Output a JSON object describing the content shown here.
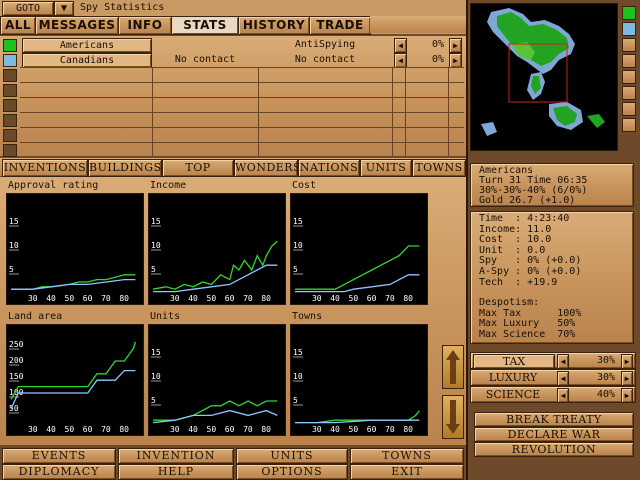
{
  "window": {
    "goto_label": "GOTO",
    "pin_glyph": "▼",
    "title": "Spy Statistics"
  },
  "tabs": [
    {
      "label": "ALL"
    },
    {
      "label": "MESSAGES"
    },
    {
      "label": "INFO"
    },
    {
      "label": "STATS",
      "active": true
    },
    {
      "label": "HISTORY"
    },
    {
      "label": "TRADE"
    }
  ],
  "nations": [
    {
      "name": "Americans",
      "col2": "",
      "col3": "AntiSpying",
      "pct": "0%",
      "color": "#1fc11f"
    },
    {
      "name": "Canadians",
      "col2": "No contact",
      "col3": "No contact",
      "pct": "0%",
      "color": "#7fb8e0"
    }
  ],
  "subtabs": [
    "INVENTIONS",
    "BUILDINGS",
    "TOP TOWNS",
    "WONDERS",
    "NATIONS",
    "UNITS",
    "TOWNS"
  ],
  "chart_data": [
    {
      "type": "line",
      "title": "Approval rating",
      "x_ticks": [
        "30",
        "40",
        "50",
        "60",
        "70",
        "80"
      ],
      "y_ticks": [
        "5",
        "10",
        "15"
      ],
      "xlim": [
        18,
        88
      ],
      "ylim": [
        0,
        20
      ],
      "series": [
        {
          "color": "#2fd82f",
          "x": [
            18,
            30,
            35,
            40,
            50,
            55,
            60,
            65,
            70,
            75,
            80,
            86
          ],
          "y": [
            1,
            1,
            1.5,
            1.5,
            2,
            2.5,
            2.5,
            3,
            3,
            3.5,
            4,
            4
          ]
        },
        {
          "color": "#8fc6ff",
          "x": [
            18,
            30,
            40,
            50,
            60,
            70,
            80,
            86
          ],
          "y": [
            1,
            1,
            1.5,
            2,
            2,
            2.5,
            3,
            3
          ]
        }
      ]
    },
    {
      "type": "line",
      "title": "Income",
      "x_ticks": [
        "30",
        "40",
        "50",
        "60",
        "70",
        "80"
      ],
      "y_ticks": [
        "5",
        "10",
        "15"
      ],
      "xlim": [
        18,
        88
      ],
      "ylim": [
        0,
        20
      ],
      "series": [
        {
          "color": "#2fd82f",
          "x": [
            18,
            25,
            30,
            35,
            40,
            45,
            50,
            55,
            60,
            62,
            65,
            68,
            70,
            72,
            75,
            78,
            80,
            83,
            86
          ],
          "y": [
            1,
            1.5,
            1,
            2,
            1.5,
            2.5,
            2,
            4,
            3,
            6,
            5,
            7,
            6,
            5,
            8,
            6,
            8,
            10,
            11
          ]
        },
        {
          "color": "#8fc6ff",
          "x": [
            18,
            30,
            40,
            50,
            60,
            65,
            70,
            75,
            80,
            86
          ],
          "y": [
            0.5,
            0.5,
            1,
            1.5,
            2,
            3,
            4,
            5,
            6,
            6
          ]
        }
      ]
    },
    {
      "type": "line",
      "title": "Cost",
      "x_ticks": [
        "30",
        "40",
        "50",
        "60",
        "70",
        "80"
      ],
      "y_ticks": [
        "5",
        "10",
        "15"
      ],
      "xlim": [
        18,
        88
      ],
      "ylim": [
        0,
        20
      ],
      "series": [
        {
          "color": "#2fd82f",
          "x": [
            18,
            40,
            45,
            50,
            55,
            60,
            65,
            70,
            75,
            80,
            86
          ],
          "y": [
            1,
            1,
            2,
            3,
            4,
            5,
            6,
            7,
            8,
            10,
            10
          ]
        },
        {
          "color": "#8fc6ff",
          "x": [
            18,
            45,
            50,
            60,
            70,
            75,
            80,
            86
          ],
          "y": [
            0.5,
            0.5,
            1,
            1.5,
            2,
            3,
            4,
            4
          ]
        }
      ]
    },
    {
      "type": "line",
      "title": "Land area",
      "x_ticks": [
        "30",
        "40",
        "50",
        "60",
        "70",
        "80"
      ],
      "y_ticks": [
        "50",
        "100",
        "150",
        "200",
        "250"
      ],
      "xlim": [
        18,
        88
      ],
      "ylim": [
        0,
        300
      ],
      "series": [
        {
          "color": "#2fd82f",
          "x": [
            18,
            22,
            40,
            60,
            65,
            70,
            75,
            80,
            85,
            86
          ],
          "y": [
            80,
            120,
            120,
            120,
            160,
            160,
            200,
            200,
            240,
            260
          ]
        },
        {
          "color": "#8fc6ff",
          "x": [
            18,
            22,
            40,
            60,
            65,
            75,
            80,
            86
          ],
          "y": [
            50,
            100,
            100,
            100,
            140,
            140,
            170,
            170
          ]
        }
      ]
    },
    {
      "type": "line",
      "title": "Units",
      "x_ticks": [
        "30",
        "40",
        "50",
        "60",
        "70",
        "80"
      ],
      "y_ticks": [
        "5",
        "10",
        "15"
      ],
      "xlim": [
        18,
        88
      ],
      "ylim": [
        0,
        20
      ],
      "series": [
        {
          "color": "#2fd82f",
          "x": [
            18,
            30,
            40,
            45,
            50,
            55,
            60,
            65,
            70,
            75,
            80,
            86
          ],
          "y": [
            1,
            1,
            2,
            3,
            4,
            4,
            5,
            4,
            5,
            4,
            5,
            5
          ]
        },
        {
          "color": "#8fc6ff",
          "x": [
            18,
            30,
            40,
            50,
            60,
            70,
            80,
            86
          ],
          "y": [
            0.5,
            1,
            2,
            2,
            3,
            2,
            3,
            2
          ]
        }
      ]
    },
    {
      "type": "line",
      "title": "Towns",
      "x_ticks": [
        "30",
        "40",
        "50",
        "60",
        "70",
        "80"
      ],
      "y_ticks": [
        "5",
        "10",
        "15"
      ],
      "xlim": [
        18,
        88
      ],
      "ylim": [
        0,
        20
      ],
      "series": [
        {
          "color": "#2fd82f",
          "x": [
            18,
            30,
            40,
            60,
            70,
            80,
            84,
            86
          ],
          "y": [
            0.5,
            0.5,
            1,
            1,
            1,
            1,
            2,
            3
          ]
        },
        {
          "color": "#8fc6ff",
          "x": [
            18,
            30,
            40,
            60,
            70,
            80,
            86
          ],
          "y": [
            0.5,
            0.5,
            0.5,
            1,
            1,
            1,
            1
          ]
        }
      ]
    }
  ],
  "bottom_menu": [
    "EVENTS",
    "INVENTION",
    "UNITS",
    "TOWNS",
    "DIPLOMACY",
    "HELP",
    "OPTIONS",
    "EXIT"
  ],
  "status": {
    "lines": [
      "Americans",
      "Turn 31 Time 06:35",
      "30%-30%-40% (6/0%)",
      "Gold 26.7 (+1.0)"
    ]
  },
  "details": {
    "lines": [
      "Time  : 4:23:40",
      "Income: 11.0",
      "Cost  : 10.0",
      "Unit  : 0.0",
      "Spy   : 0% (+0.0)",
      "A-Spy : 0% (+0.0)",
      "Tech  : +19.9",
      "",
      "Despotism:",
      "Max Tax      100%",
      "Max Luxury   50%",
      "Max Science  70%"
    ]
  },
  "rates": [
    {
      "label": "TAX",
      "value": "30%"
    },
    {
      "label": "LUXURY",
      "value": "30%"
    },
    {
      "label": "SCIENCE",
      "value": "40%"
    }
  ],
  "actions": [
    "BREAK TREATY",
    "DECLARE WAR",
    "REVOLUTION"
  ],
  "colors": {
    "player": "#1fc11f",
    "rival": "#7fb8e0",
    "wood": "#c8955d"
  }
}
